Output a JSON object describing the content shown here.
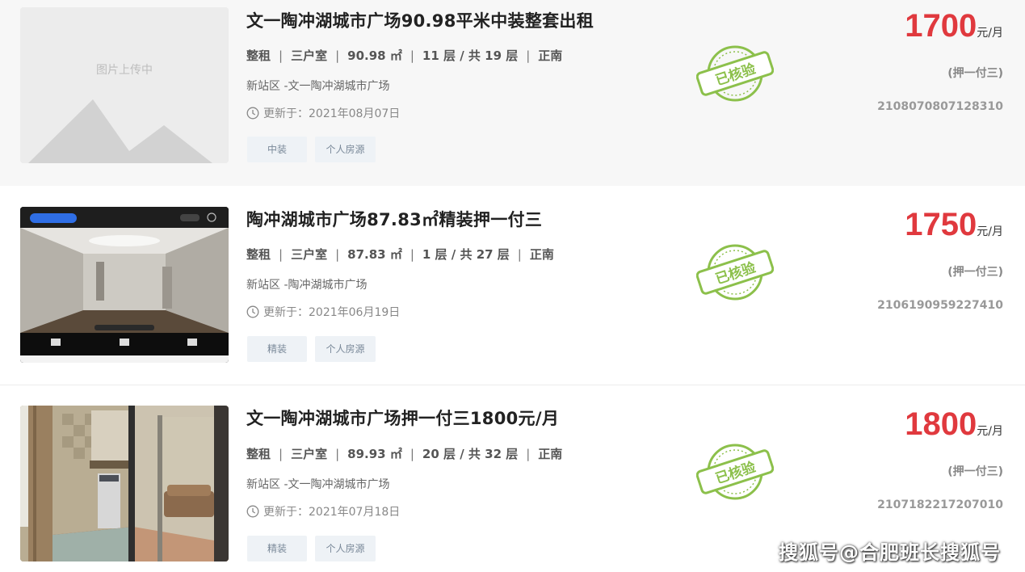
{
  "listings": [
    {
      "title": "文一陶冲湖城市广场90.98平米中装整套出租",
      "placeholder_text": "图片上传中",
      "rent_type": "整租",
      "rooms": "三户室",
      "area": "90.98 ㎡",
      "floor": "11 层 / 共 19 层",
      "orientation": "正南",
      "address": "新站区 -文一陶冲湖城市广场",
      "updated": "更新于：2021年08月07日",
      "tags": [
        "中装",
        "个人房源"
      ],
      "stamp_text": "已核验",
      "price": "1700",
      "price_unit": "元/月",
      "deposit": "(押一付三)",
      "code": "2108070807128310"
    },
    {
      "title": "陶冲湖城市广场87.83㎡精装押一付三",
      "rent_type": "整租",
      "rooms": "三户室",
      "area": "87.83 ㎡",
      "floor": "1 层 / 共 27 层",
      "orientation": "正南",
      "address": "新站区 -陶冲湖城市广场",
      "updated": "更新于：2021年06月19日",
      "tags": [
        "精装",
        "个人房源"
      ],
      "stamp_text": "已核验",
      "price": "1750",
      "price_unit": "元/月",
      "deposit": "(押一付三)",
      "code": "2106190959227410"
    },
    {
      "title": "文一陶冲湖城市广场押一付三1800元/月",
      "rent_type": "整租",
      "rooms": "三户室",
      "area": "89.93 ㎡",
      "floor": "20 层 / 共 32 层",
      "orientation": "正南",
      "address": "新站区 -文一陶冲湖城市广场",
      "updated": "更新于：2021年07月18日",
      "tags": [
        "精装",
        "个人房源"
      ],
      "stamp_text": "已核验",
      "price": "1800",
      "price_unit": "元/月",
      "deposit": "(押一付三)",
      "code": "2107182217207010"
    }
  ],
  "watermark": "搜狐号@合肥班长搜狐号",
  "colors": {
    "price": "#e0393e",
    "stamp": "#8cc04b",
    "tag_bg": "#eef2f6"
  }
}
